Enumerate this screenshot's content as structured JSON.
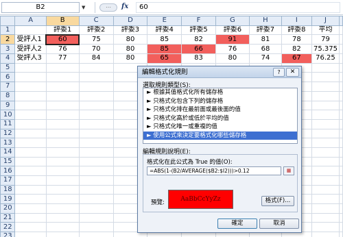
{
  "formula_bar": {
    "name_box": "B2",
    "name_dropdown": "▼",
    "fx": "fx",
    "value": "60"
  },
  "sheet": {
    "columns": [
      "A",
      "B",
      "C",
      "D",
      "E",
      "F",
      "G",
      "H",
      "I",
      "J"
    ],
    "header_row": [
      "",
      "評委1",
      "評委2",
      "評委3",
      "評委4",
      "評委5",
      "評委6",
      "評委7",
      "評委8",
      "平均"
    ],
    "data_rows": [
      {
        "name": "受評人1",
        "values": [
          "60",
          "75",
          "80",
          "85",
          "82",
          "91",
          "81",
          "78"
        ],
        "avg": "79"
      },
      {
        "name": "受評人2",
        "values": [
          "76",
          "70",
          "80",
          "85",
          "66",
          "76",
          "68",
          "82"
        ],
        "avg": "75.375"
      },
      {
        "name": "受評人3",
        "values": [
          "77",
          "84",
          "80",
          "65",
          "83",
          "80",
          "74",
          "67"
        ],
        "avg": "76.25"
      }
    ],
    "row_numbers": [
      "1",
      "2",
      "3",
      "4",
      "5",
      "6",
      "7",
      "8",
      "9",
      "10",
      "11",
      "12",
      "13",
      "14",
      "15",
      "16",
      "17",
      "18",
      "19",
      "20",
      "21",
      "22",
      "23"
    ],
    "highlight_color": "#f25f5c",
    "selected_cell": "B2"
  },
  "dialog": {
    "title": "編輯格式化規則",
    "help": "?",
    "close": "✕",
    "select_rule_type_label": "選取規則類型(S):",
    "rule_types": [
      "► 根據其值格式化所有儲存格",
      "► 只格式化包含下列的儲存格",
      "► 只格式化排在最前面或最後面的值",
      "► 只格式化高於或低於平均的值",
      "► 只格式化唯一或重複的值",
      "► 使用公式來決定要格式化哪些儲存格"
    ],
    "selected_rule_index": 5,
    "edit_desc_label": "編輯規則說明(E):",
    "formula_label": "格式化在此公式為 True 的值(O):",
    "formula": "=ABS(1-(B2/AVERAGE($B2:$I2)))>0.12",
    "collapse_icon": "range-select-icon",
    "preview_label": "預覽:",
    "preview_text": "AaBbCcYyZz",
    "preview_color": "#ff0000",
    "format_button": "格式(F)...",
    "ok_button": "確定",
    "cancel_button": "取消"
  }
}
